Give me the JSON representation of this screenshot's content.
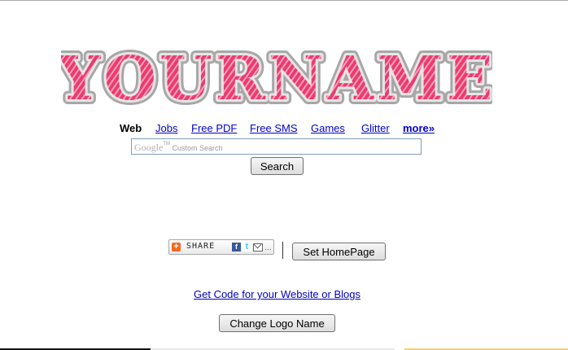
{
  "logo": {
    "text": "YOURNAME",
    "fill_color": "#ec3a6e",
    "outline_color": "#a7a7a7"
  },
  "nav": {
    "current": "Web",
    "links": [
      "Jobs",
      "Free PDF",
      "Free SMS",
      "Games",
      "Glitter",
      "more»"
    ]
  },
  "search": {
    "placeholder_brand": "Google",
    "placeholder_tm": "TM",
    "placeholder_text": "Custom Search",
    "value": "",
    "button_label": "Search"
  },
  "share_widget": {
    "label": "SHARE",
    "icons": [
      "plus-icon",
      "facebook-icon",
      "twitter-icon",
      "email-icon",
      "more-dots-icon"
    ]
  },
  "homepage_button": "Set HomePage",
  "get_code_link": "Get Code for your Website or Blogs",
  "change_logo_button": "Change Logo Name",
  "colors": {
    "link": "#0000cc",
    "share_plus": "#f26922",
    "facebook": "#3b5998",
    "twitter": "#33ccff"
  }
}
